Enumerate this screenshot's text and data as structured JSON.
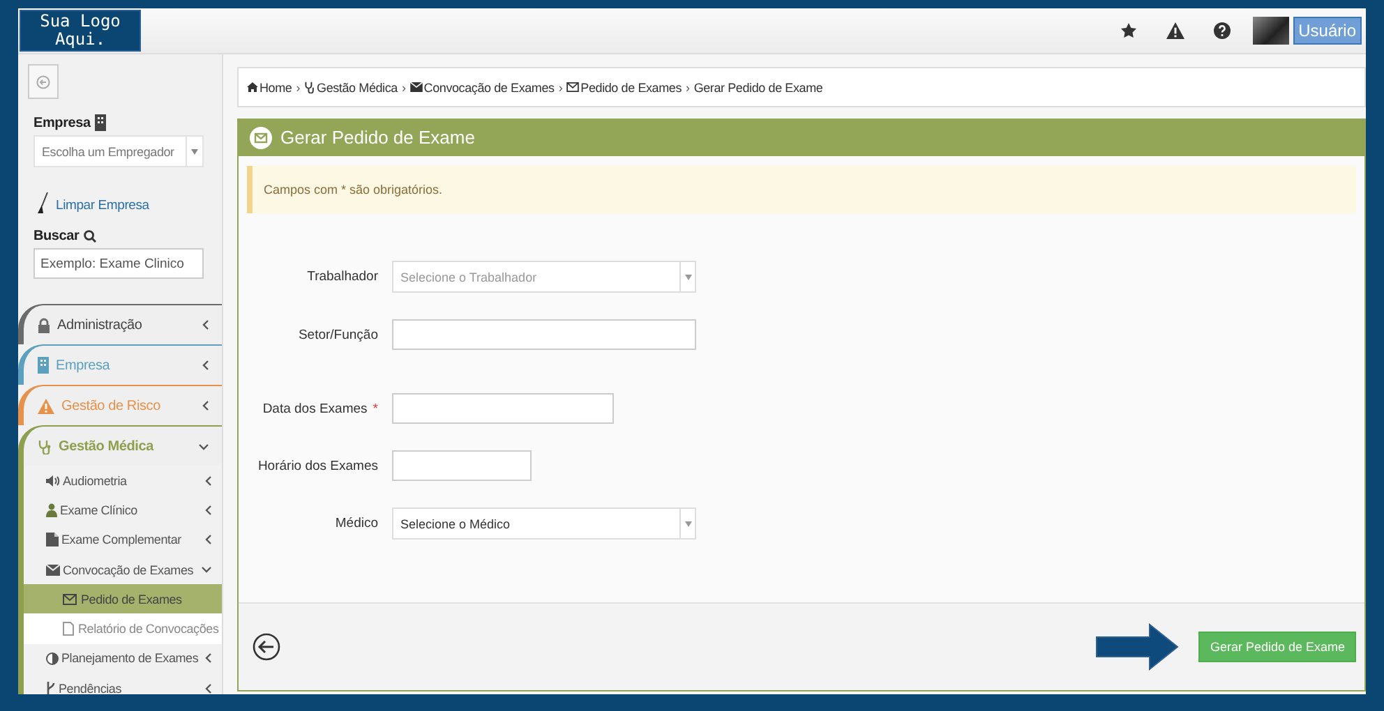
{
  "header": {
    "logo": "Sua Logo Aqui.",
    "user_button": "Usuário"
  },
  "sidebar": {
    "company_label": "Empresa",
    "company_select": {
      "placeholder": "Escolha um Empregador"
    },
    "clear_link": "Limpar Empresa",
    "search_label": "Buscar",
    "search": {
      "placeholder": "Exemplo: Exame Clinico"
    },
    "menu": [
      {
        "label": "Administração",
        "color": "#6b6b6b",
        "expanded": false
      },
      {
        "label": "Empresa",
        "color": "#5ba0bd",
        "expanded": false
      },
      {
        "label": "Gestão de Risco",
        "color": "#e8914a",
        "expanded": false
      },
      {
        "label": "Gestão Médica",
        "color": "#8ea04f",
        "expanded": true,
        "children": [
          {
            "label": "Audiometria",
            "expanded": false
          },
          {
            "label": "Exame Clínico",
            "expanded": false
          },
          {
            "label": "Exame Complementar",
            "expanded": false
          },
          {
            "label": "Convocação de Exames",
            "expanded": true,
            "children": [
              {
                "label": "Pedido de Exames",
                "selected": true
              },
              {
                "label": "Relatório de Convocações",
                "selected": false
              }
            ]
          },
          {
            "label": "Planejamento de Exames",
            "expanded": false
          },
          {
            "label": "Pendências",
            "expanded": false
          }
        ]
      }
    ]
  },
  "breadcrumb": [
    {
      "label": "Home",
      "separator": "›"
    },
    {
      "label": "Gestão Médica",
      "separator": "›"
    },
    {
      "label": "Convocação de Exames",
      "separator": "›"
    },
    {
      "label": "Pedido de Exames",
      "separator": "›"
    },
    {
      "label": "Gerar Pedido de Exame"
    }
  ],
  "panel": {
    "title": "Gerar Pedido de Exame",
    "alert": "Campos com * são obrigatórios.",
    "fields": [
      {
        "kind": "select",
        "label": "Trabalhador",
        "placeholder": "Selecione o Trabalhador"
      },
      {
        "kind": "text",
        "label": "Setor/Função"
      },
      {
        "kind": "date",
        "label": "Data dos Exames",
        "required_mark": "*"
      },
      {
        "kind": "time",
        "label": "Horário dos Exames"
      },
      {
        "kind": "select",
        "label": "Médico",
        "value": "Selecione o Médico"
      }
    ],
    "submit_button": "Gerar Pedido de Exame"
  }
}
